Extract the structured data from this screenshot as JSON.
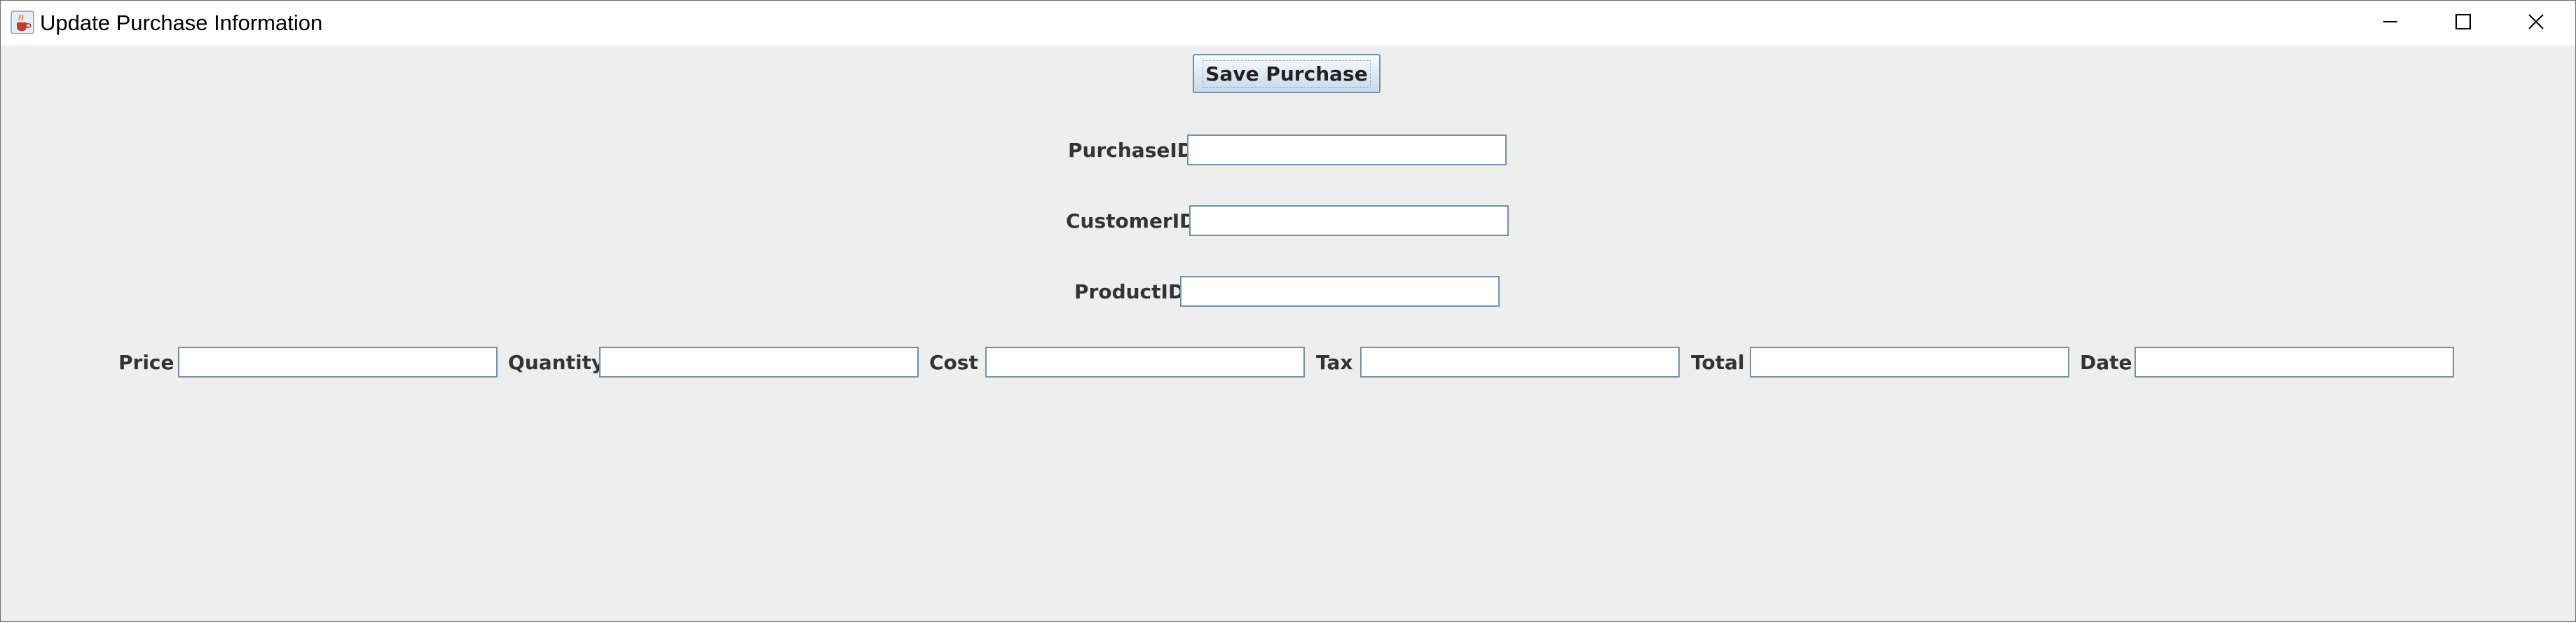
{
  "window": {
    "title": "Update Purchase Information",
    "minimize_icon": "minimize-icon",
    "maximize_icon": "maximize-icon",
    "close_icon": "close-icon",
    "app_icon": "java-cup-icon"
  },
  "toolbar": {
    "save_label": "Save Purchase"
  },
  "form": {
    "purchase_id": {
      "label": "PurchaseID",
      "value": ""
    },
    "customer_id": {
      "label": "CustomerID",
      "value": ""
    },
    "product_id": {
      "label": "ProductID",
      "value": ""
    },
    "price": {
      "label": "Price",
      "value": ""
    },
    "quantity": {
      "label": "Quantity",
      "value": ""
    },
    "cost": {
      "label": "Cost",
      "value": ""
    },
    "tax": {
      "label": "Tax",
      "value": ""
    },
    "total": {
      "label": "Total",
      "value": ""
    },
    "date": {
      "label": "Date",
      "value": ""
    }
  },
  "colors": {
    "background": "#eeeeee",
    "field_border": "#7a8ea8",
    "label_text": "#333333"
  }
}
